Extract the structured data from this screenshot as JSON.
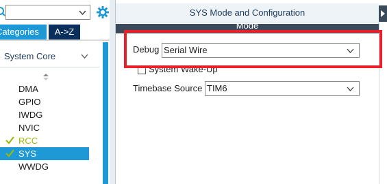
{
  "left": {
    "search": {
      "value": ""
    },
    "tabs": {
      "categories": "Categories",
      "az": "A->Z"
    },
    "category": {
      "label": "System Core"
    },
    "items": [
      {
        "label": "DMA",
        "status": "none"
      },
      {
        "label": "GPIO",
        "status": "none"
      },
      {
        "label": "IWDG",
        "status": "none"
      },
      {
        "label": "NVIC",
        "status": "none"
      },
      {
        "label": "RCC",
        "status": "ok"
      },
      {
        "label": "SYS",
        "status": "ok",
        "selected": true
      },
      {
        "label": "WWDG",
        "status": "none"
      }
    ]
  },
  "right": {
    "title": "SYS Mode and Configuration",
    "mode_header": "Mode",
    "debug": {
      "label": "Debug",
      "value": "Serial Wire"
    },
    "wakeup": {
      "label": "System Wake-Up",
      "checked": false
    },
    "timebase": {
      "label": "Timebase Source",
      "value": "TIM6"
    }
  },
  "colors": {
    "accent_blue": "#1f98d6",
    "dark_navy": "#0a2f5c",
    "ok_green": "#9bbb0c",
    "highlight_red": "#e8202a",
    "mode_bar": "#3b4a5a"
  },
  "icons": {
    "search": "search-icon",
    "gear": "gear-icon",
    "chevron": "chevron-down-icon",
    "sort": "sort-icon",
    "check": "check-icon",
    "collapse": "collapse-arrow-icon"
  }
}
